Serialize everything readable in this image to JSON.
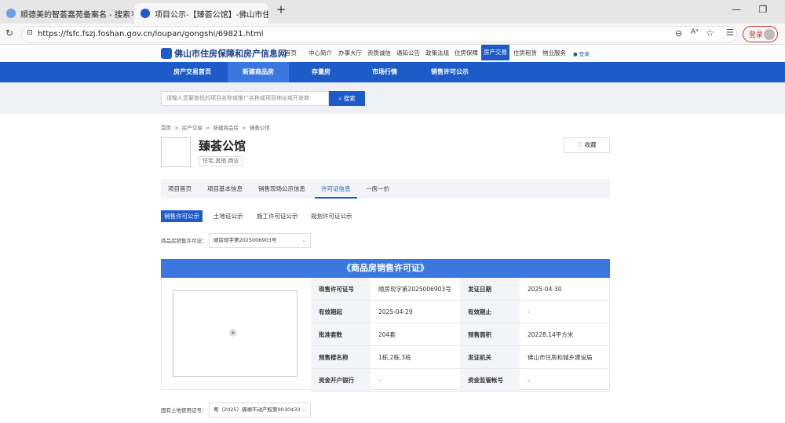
{
  "browser": {
    "tabs": [
      {
        "title": "顺德美的智荟嘉苑备案名 - 搜索",
        "active": false
      },
      {
        "title": "项目公示-【臻荟公馆】-佛山市住",
        "active": true
      }
    ],
    "new_tab": "+",
    "url": "https://fsfc.fszj.foshan.gov.cn/loupan/gongshi/69821.html",
    "login_label": "登录"
  },
  "site": {
    "logo_text": "佛山市住房保障和房产信息网",
    "top_nav": [
      "首页",
      "中心简介",
      "办事大厅",
      "资质诚信",
      "通知公告",
      "政策法规",
      "住房保障",
      "房产交易",
      "住房租赁",
      "物业服务"
    ],
    "top_nav_active": "房产交易",
    "login_link": "登录",
    "main_nav": [
      "房产交易首页",
      "新建商品房",
      "存量房",
      "市场行情",
      "销售许可公示"
    ],
    "main_nav_active": "新建商品房",
    "search_placeholder": "请输入您要查找的项目名称或推广名称或项目地址或开发商",
    "search_button": "搜索"
  },
  "breadcrumb": [
    "首页",
    ">",
    "房产交易",
    ">",
    "新建商品房",
    ">",
    "臻荟公馆"
  ],
  "project": {
    "name": "臻荟公馆",
    "tag": "住宅,其他,商业",
    "fav_label": "收藏"
  },
  "project_tabs": [
    "项目首页",
    "项目基本信息",
    "销售现场公示信息",
    "许可证信息",
    "一房一价"
  ],
  "project_tab_active": "许可证信息",
  "sub_tabs": [
    "销售许可公示",
    "土地证公示",
    "施工许可证公示",
    "规划许可证公示"
  ],
  "sub_tab_active": "销售许可公示",
  "permit_select": {
    "label": "商品房销售许可证：",
    "value": "顺房现字第2025006903号"
  },
  "certificate": {
    "title": "《商品房销售许可证》",
    "rows": [
      {
        "k1": "现售许可证号",
        "v1": "顺房现字第2025006903号",
        "k2": "发证日期",
        "v2": "2025-04-30"
      },
      {
        "k1": "有效期起",
        "v1": "2025-04-29",
        "k2": "有效期止",
        "v2": "-"
      },
      {
        "k1": "批准套数",
        "v1": "204套",
        "k2": "预售面积",
        "v2": "20228.14平方米"
      },
      {
        "k1": "预售楼名称",
        "v1": "1栋,2栋,3栋",
        "k2": "发证机关",
        "v2": "佛山市住房和城乡建设局"
      },
      {
        "k1": "资金开户银行",
        "v1": "-",
        "k2": "资金监管帐号",
        "v2": "-"
      }
    ]
  },
  "land_select": {
    "label": "国有土地使用证号：",
    "value": "粤（2025）佛顺不动产权第0030433"
  },
  "colors": {
    "brand_blue": "#1c5bc8",
    "header_blue": "#3a78e0",
    "login_red": "#c83232"
  }
}
